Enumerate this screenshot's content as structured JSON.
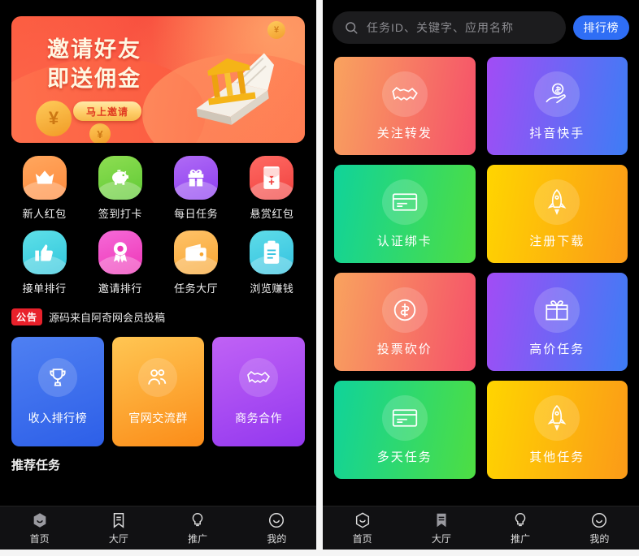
{
  "left": {
    "banner": {
      "line1": "邀请好友",
      "line2": "即送佣金",
      "button": "马上邀请",
      "coin_symbol": "¥",
      "coin_symbol2": "¥",
      "coin_symbol3": "¥"
    },
    "icons": [
      {
        "label": "新人红包",
        "icon": "crown-icon",
        "c1": "#ffa75e",
        "c2": "#ff8a3d"
      },
      {
        "label": "签到打卡",
        "icon": "piggy-bank-icon",
        "c1": "#8ede52",
        "c2": "#5fc935"
      },
      {
        "label": "每日任务",
        "icon": "gift-icon",
        "c1": "#b06bf5",
        "c2": "#8c3df0"
      },
      {
        "label": "悬赏红包",
        "icon": "red-packet-icon",
        "c1": "#ff6a63",
        "c2": "#f0413f"
      },
      {
        "label": "接单排行",
        "icon": "thumbs-up-icon",
        "c1": "#5fe0e8",
        "c2": "#2fc6dc"
      },
      {
        "label": "邀请排行",
        "icon": "medal-icon",
        "c1": "#f56ad8",
        "c2": "#ee35b6"
      },
      {
        "label": "任务大厅",
        "icon": "wallet-icon",
        "c1": "#ffc36a",
        "c2": "#f7a531"
      },
      {
        "label": "浏览赚钱",
        "icon": "clipboard-icon",
        "c1": "#5fdce8",
        "c2": "#33c2e0"
      }
    ],
    "notice": {
      "badge": "公告",
      "text": "源码来自阿奇网会员投稿"
    },
    "cards": [
      {
        "label": "收入排行榜",
        "icon": "trophy-icon",
        "c1": "#4f80f2",
        "c2": "#2d5fe8"
      },
      {
        "label": "官网交流群",
        "icon": "people-icon",
        "c1": "#ffc653",
        "c2": "#fb8c18"
      },
      {
        "label": "商务合作",
        "icon": "handshake-icon",
        "c1": "#c062f5",
        "c2": "#9338ef"
      }
    ],
    "section_title": "推荐任务",
    "tabs": [
      {
        "label": "首页",
        "icon": "hexagon-smile-icon",
        "active": true
      },
      {
        "label": "大厅",
        "icon": "bookmark-icon",
        "active": false
      },
      {
        "label": "推广",
        "icon": "bulb-icon",
        "active": false
      },
      {
        "label": "我的",
        "icon": "smile-face-icon",
        "active": false
      }
    ]
  },
  "right": {
    "search": {
      "placeholder": "任务ID、关键字、应用名称",
      "value": "",
      "icon": "search-icon"
    },
    "rank_button": "排行榜",
    "rank_button_color": "#2f6ef5",
    "tiles": [
      {
        "label": "关注转发",
        "icon": "handshake-icon",
        "c1": "#f9a35e",
        "c2": "#f5506a"
      },
      {
        "label": "抖音快手",
        "icon": "hand-dollar-icon",
        "c1": "#a24cf5",
        "c2": "#3d7df5"
      },
      {
        "label": "认证绑卡",
        "icon": "card-icon",
        "c1": "#10d39a",
        "c2": "#4ede42"
      },
      {
        "label": "注册下载",
        "icon": "rocket-icon",
        "c1": "#ffd500",
        "c2": "#fb9a18"
      },
      {
        "label": "投票砍价",
        "icon": "dollar-circle-icon",
        "c1": "#f9a35e",
        "c2": "#f5506a"
      },
      {
        "label": "高价任务",
        "icon": "gift-icon",
        "c1": "#a24cf5",
        "c2": "#3d7df5"
      },
      {
        "label": "多天任务",
        "icon": "card-icon",
        "c1": "#10d39a",
        "c2": "#4ede42"
      },
      {
        "label": "其他任务",
        "icon": "rocket-icon",
        "c1": "#ffd500",
        "c2": "#fb9a18"
      }
    ],
    "tabs": [
      {
        "label": "首页",
        "icon": "hexagon-smile-icon",
        "active": false
      },
      {
        "label": "大厅",
        "icon": "bookmark-icon",
        "active": true
      },
      {
        "label": "推广",
        "icon": "bulb-icon",
        "active": false
      },
      {
        "label": "我的",
        "icon": "smile-face-icon",
        "active": false
      }
    ]
  }
}
